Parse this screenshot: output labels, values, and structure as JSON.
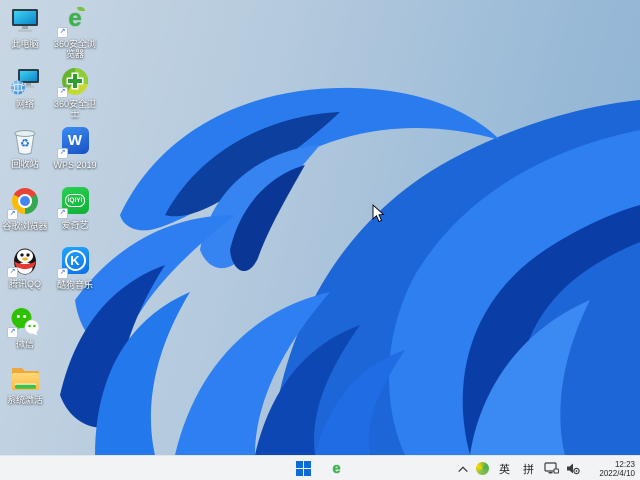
{
  "wallpaper": {
    "style": "windows-11-bloom",
    "colors": {
      "background_left": "#c9d7e4",
      "background_right": "#8db2d2",
      "bloom_bright": "#2e7ff0",
      "bloom_mid": "#1c66d8",
      "bloom_dark": "#0b3da6",
      "taskbar": "#f1f3f5"
    }
  },
  "desktop": {
    "icons": [
      {
        "icon": "this-pc",
        "label": "此电脑"
      },
      {
        "icon": "network",
        "label": "网络"
      },
      {
        "icon": "recycle-bin",
        "label": "回收站"
      },
      {
        "icon": "chrome",
        "label": "谷歌浏览器"
      },
      {
        "icon": "tencent-qq",
        "label": "腾讯QQ"
      },
      {
        "icon": "wechat",
        "label": "微信"
      },
      {
        "icon": "activation-folder",
        "label": "系统激活"
      },
      {
        "icon": "360-browser",
        "label": "360安全浏览器"
      },
      {
        "icon": "360-guard",
        "label": "360安全卫士"
      },
      {
        "icon": "wps",
        "label": "WPS 2019"
      },
      {
        "icon": "iqiyi",
        "label": "爱奇艺"
      },
      {
        "icon": "kugou-music",
        "label": "酷狗音乐"
      }
    ],
    "iqiyi_logo_text": "iQIYI",
    "kugou_letter": "K",
    "wps_letter": "W",
    "e360_letter": "e",
    "shortcut_arrow": "↗"
  },
  "taskbar": {
    "start": "windows-start",
    "pinned": [
      {
        "icon": "360-browser"
      }
    ],
    "tray": {
      "hidden_icons_chevron": "^",
      "icons": [
        "360-guard-tray",
        "monitor",
        "volume-settings"
      ],
      "ime": {
        "english": "英",
        "pinyin": "拼"
      }
    },
    "clock": {
      "time": "12:23",
      "date": "2022/4/10"
    }
  }
}
